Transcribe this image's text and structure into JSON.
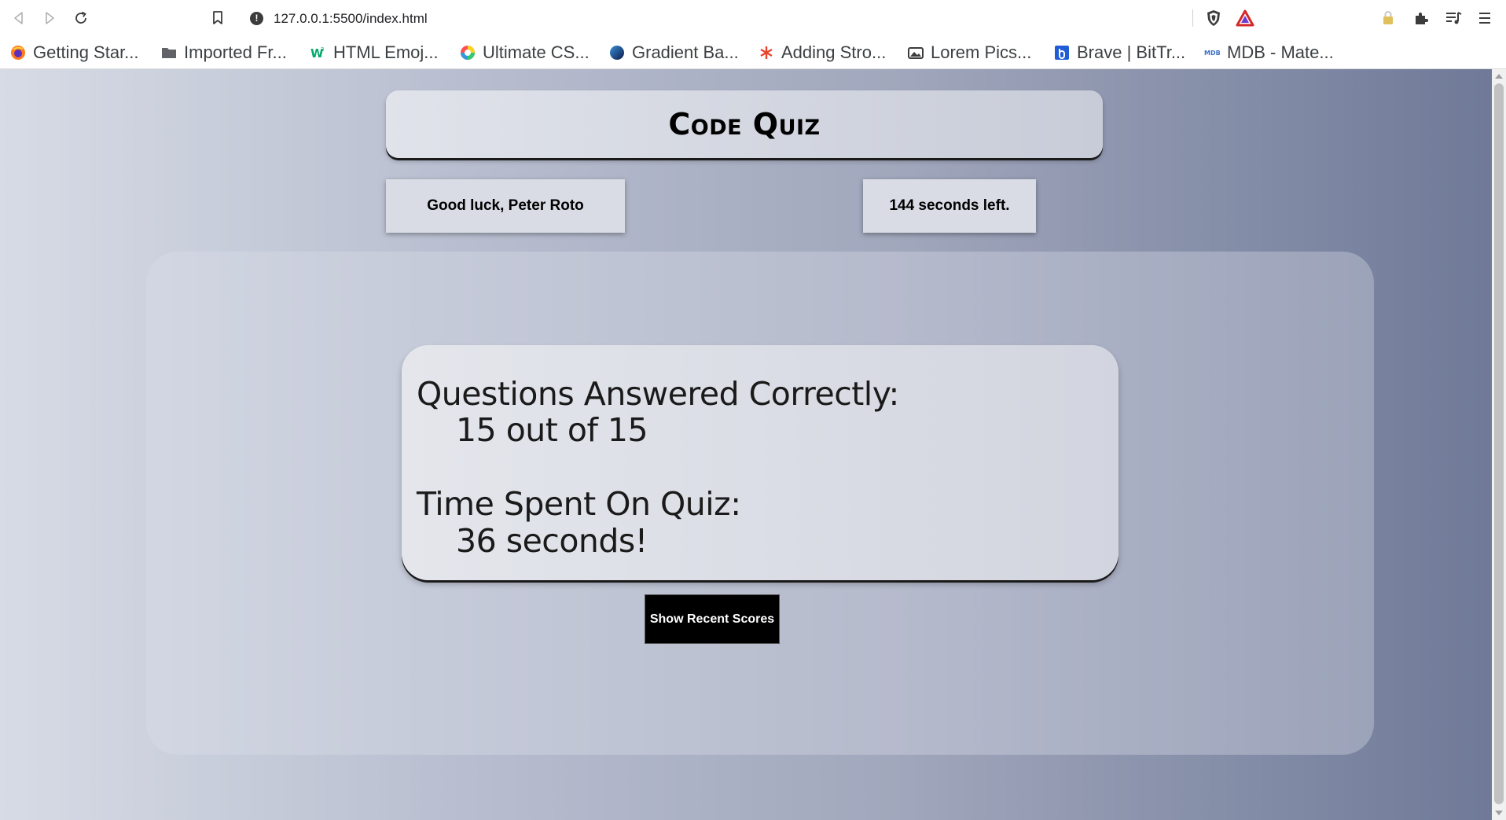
{
  "browser": {
    "url": "127.0.0.1:5500/index.html",
    "bookmarks": [
      {
        "label": "Getting Star...",
        "icon": "firefox-icon"
      },
      {
        "label": "Imported Fr...",
        "icon": "folder-icon"
      },
      {
        "label": "HTML Emoj...",
        "icon": "w3schools-icon"
      },
      {
        "label": "Ultimate CS...",
        "icon": "color-wheel-icon"
      },
      {
        "label": "Gradient Ba...",
        "icon": "gradient-circle-icon"
      },
      {
        "label": "Adding Stro...",
        "icon": "asterisk-icon"
      },
      {
        "label": "Lorem Pics...",
        "icon": "image-icon"
      },
      {
        "label": "Brave | BitTr...",
        "icon": "brave-bittorrent-icon"
      },
      {
        "label": "MDB - Mate...",
        "icon": "mdb-icon"
      }
    ]
  },
  "quiz": {
    "title": "Code Quiz",
    "greeting": "Good luck, Peter Roto",
    "timer": "144 seconds left.",
    "results": {
      "correct_label": "Questions Answered Correctly:",
      "correct_value": "15 out of 15",
      "time_label": "Time Spent On Quiz:",
      "time_value": "36 seconds!"
    },
    "show_scores_label": "Show Recent Scores"
  },
  "colors": {
    "gradient_start": "#d7dbe5",
    "gradient_end": "#6f7a98",
    "button_bg": "#000000"
  }
}
